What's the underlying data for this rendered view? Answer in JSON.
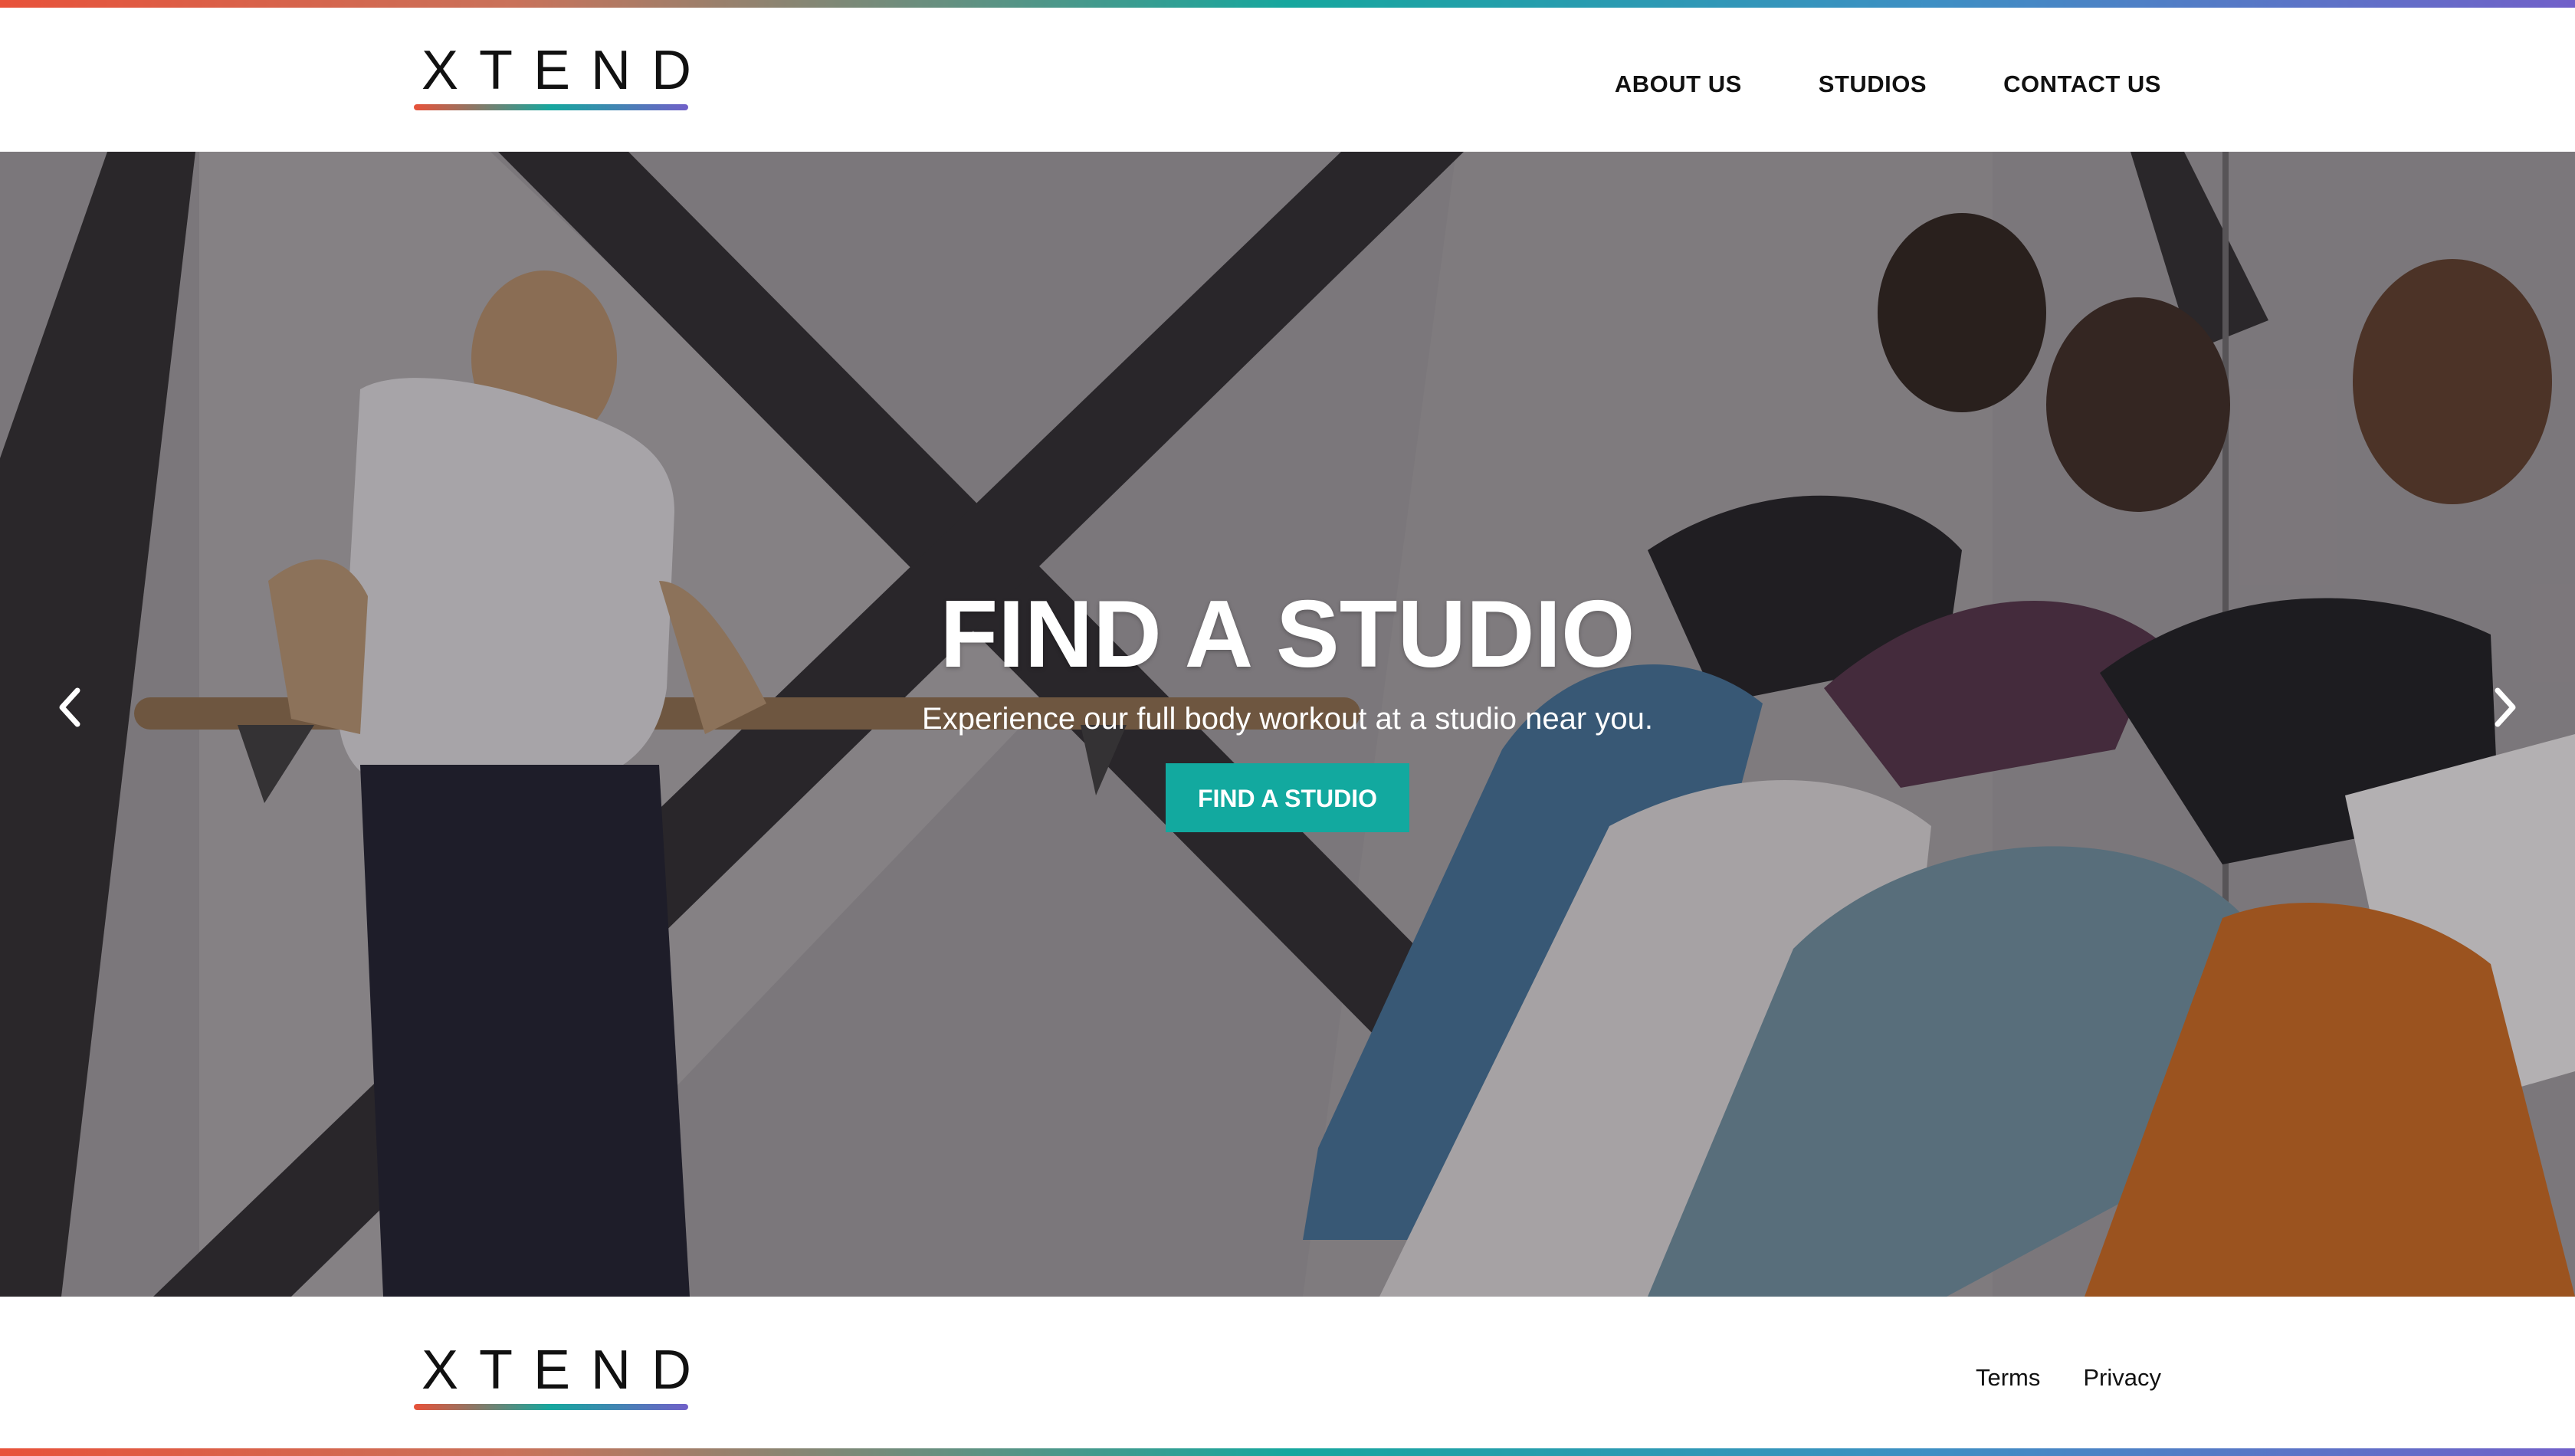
{
  "brand": {
    "logo_text": "XTEND"
  },
  "nav": {
    "items": [
      {
        "label": "ABOUT US"
      },
      {
        "label": "STUDIOS"
      },
      {
        "label": "CONTACT US"
      }
    ]
  },
  "hero": {
    "title": "FIND A STUDIO",
    "subtitle": "Experience our full body workout at a studio near you.",
    "cta_label": "FIND A STUDIO",
    "prev_icon": "chevron-left-icon",
    "next_icon": "chevron-right-icon"
  },
  "footer": {
    "links": [
      {
        "label": "Terms"
      },
      {
        "label": "Privacy"
      }
    ]
  },
  "colors": {
    "accent": "#12a99f",
    "gradient": [
      "#e8523a",
      "#16a79e",
      "#7160c9"
    ]
  }
}
